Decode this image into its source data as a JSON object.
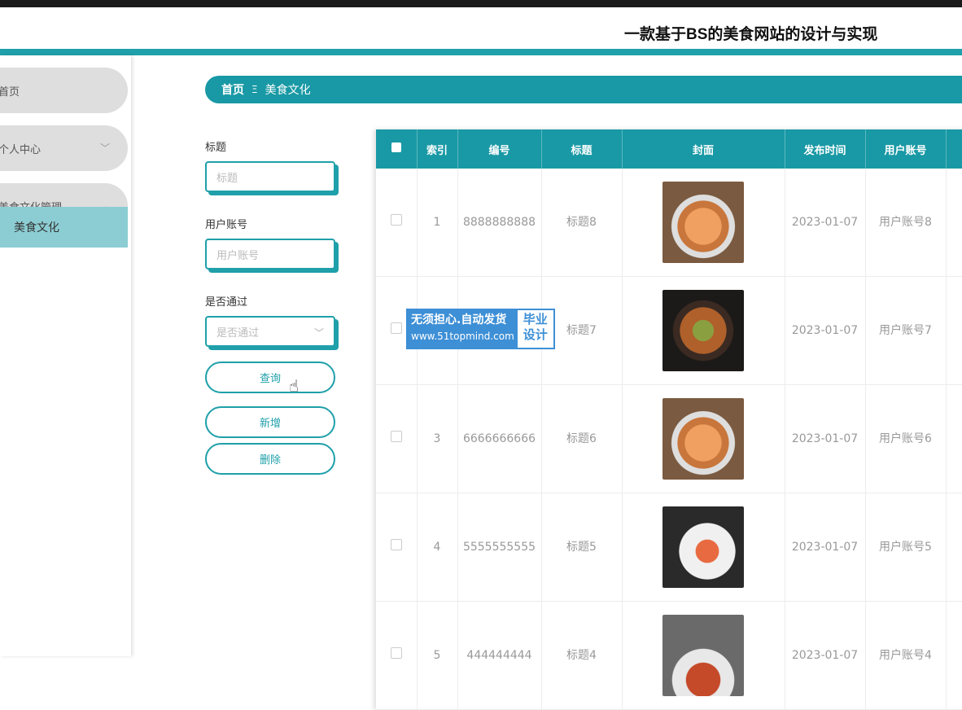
{
  "header": {
    "title": "一款基于BS的美食网站的设计与实现"
  },
  "sidebar": {
    "items": [
      {
        "label": "首页"
      },
      {
        "label": "个人中心"
      },
      {
        "label": "美食文化管理"
      }
    ],
    "subitem": {
      "label": "美食文化"
    }
  },
  "breadcrumb": {
    "home": "首页",
    "sep": "Ξ",
    "current": "美食文化"
  },
  "filters": {
    "title_label": "标题",
    "title_placeholder": "标题",
    "account_label": "用户账号",
    "account_placeholder": "用户账号",
    "approved_label": "是否通过",
    "approved_placeholder": "是否通过"
  },
  "buttons": {
    "query": "查询",
    "add": "新增",
    "delete": "删除"
  },
  "table": {
    "columns": [
      "索引",
      "编号",
      "标题",
      "封面",
      "发布时间",
      "用户账号"
    ],
    "rows": [
      {
        "index": "1",
        "number": "8888888888",
        "title": "标题8",
        "date": "2023-01-07",
        "account": "用户账号8"
      },
      {
        "index": "",
        "number": "",
        "title": "标题7",
        "date": "2023-01-07",
        "account": "用户账号7"
      },
      {
        "index": "3",
        "number": "6666666666",
        "title": "标题6",
        "date": "2023-01-07",
        "account": "用户账号6"
      },
      {
        "index": "4",
        "number": "5555555555",
        "title": "标题5",
        "date": "2023-01-07",
        "account": "用户账号5"
      },
      {
        "index": "5",
        "number": "444444444",
        "title": "标题4",
        "date": "2023-01-07",
        "account": "用户账号4"
      }
    ]
  },
  "watermark": {
    "line1": "无须担心.自动发货",
    "url": "www.51topmind.com",
    "badge1": "毕业",
    "badge2": "设计"
  },
  "colors": {
    "accent": "#1999a5",
    "sidebar_sub": "#8ccdd3",
    "watermark": "#3d8fd6"
  }
}
